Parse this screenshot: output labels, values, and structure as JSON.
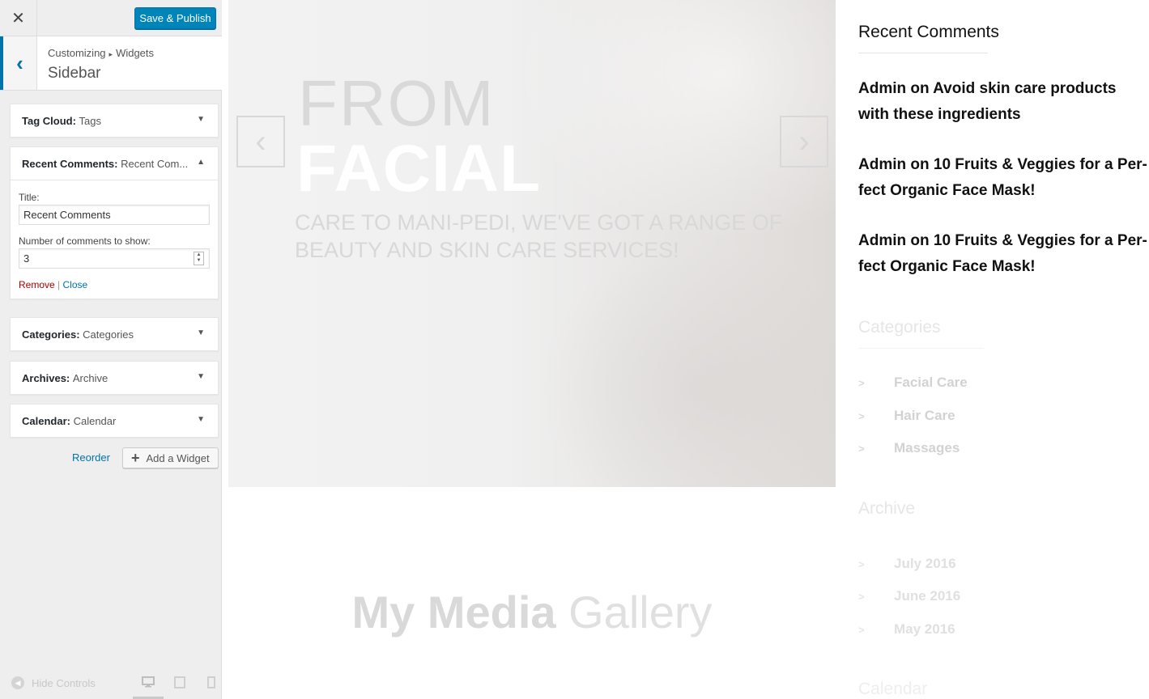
{
  "customizer": {
    "close_glyph": "✕",
    "publish_label": "Save & Publish",
    "back_glyph": "‹",
    "breadcrumb": {
      "parent": "Customizing",
      "separator": "▸",
      "child": "Widgets"
    },
    "section_title": "Sidebar",
    "widgets": [
      {
        "type": "Tag Cloud",
        "title": "Tags",
        "arrow": "▼"
      },
      {
        "type": "Recent Comments",
        "title": "Recent Com...",
        "arrow": "▲"
      },
      {
        "type": "Categories",
        "title": "Categories",
        "arrow": "▼"
      },
      {
        "type": "Archives",
        "title": "Archive",
        "arrow": "▼"
      },
      {
        "type": "Calendar",
        "title": "Calendar",
        "arrow": "▼"
      }
    ],
    "recent_comments_form": {
      "title_label": "Title:",
      "title_value": "Recent Comments",
      "count_label": "Number of comments to show:",
      "count_value": "3",
      "remove_label": "Remove",
      "divider": "|",
      "close_label": "Close"
    },
    "reorder_label": "Reorder",
    "add_widget_label": "Add a Widget",
    "hide_controls_label": "Hide Controls"
  },
  "preview": {
    "hero": {
      "line1": "FROM",
      "line2": "FACIAL",
      "subtitle": "CARE TO MANI-PEDI, WE'VE GOT A RANGE OF BEAUTY AND SKIN CARE SERVICES!",
      "prev_glyph": "‹",
      "next_glyph": "›"
    },
    "gallery": {
      "bold": "My Media",
      "light": "Gallery"
    },
    "sidebar": {
      "recent_comments_title": "Recent Comments",
      "comments": [
        "Admin on Avoid skin care products with these ingredients",
        "Admin on 10 Fruits & Veggies for a Per-fect Organic Face Mask!",
        "Admin on 10 Fruits & Veggies for a Per-fect Organic Face Mask!"
      ],
      "categories_title": "Categories",
      "categories": [
        "Facial Care",
        "Hair Care",
        "Massages"
      ],
      "archive_title": "Archive",
      "archives": [
        "July 2016",
        "June 2016",
        "May 2016"
      ],
      "calendar_title": "Calendar"
    }
  }
}
